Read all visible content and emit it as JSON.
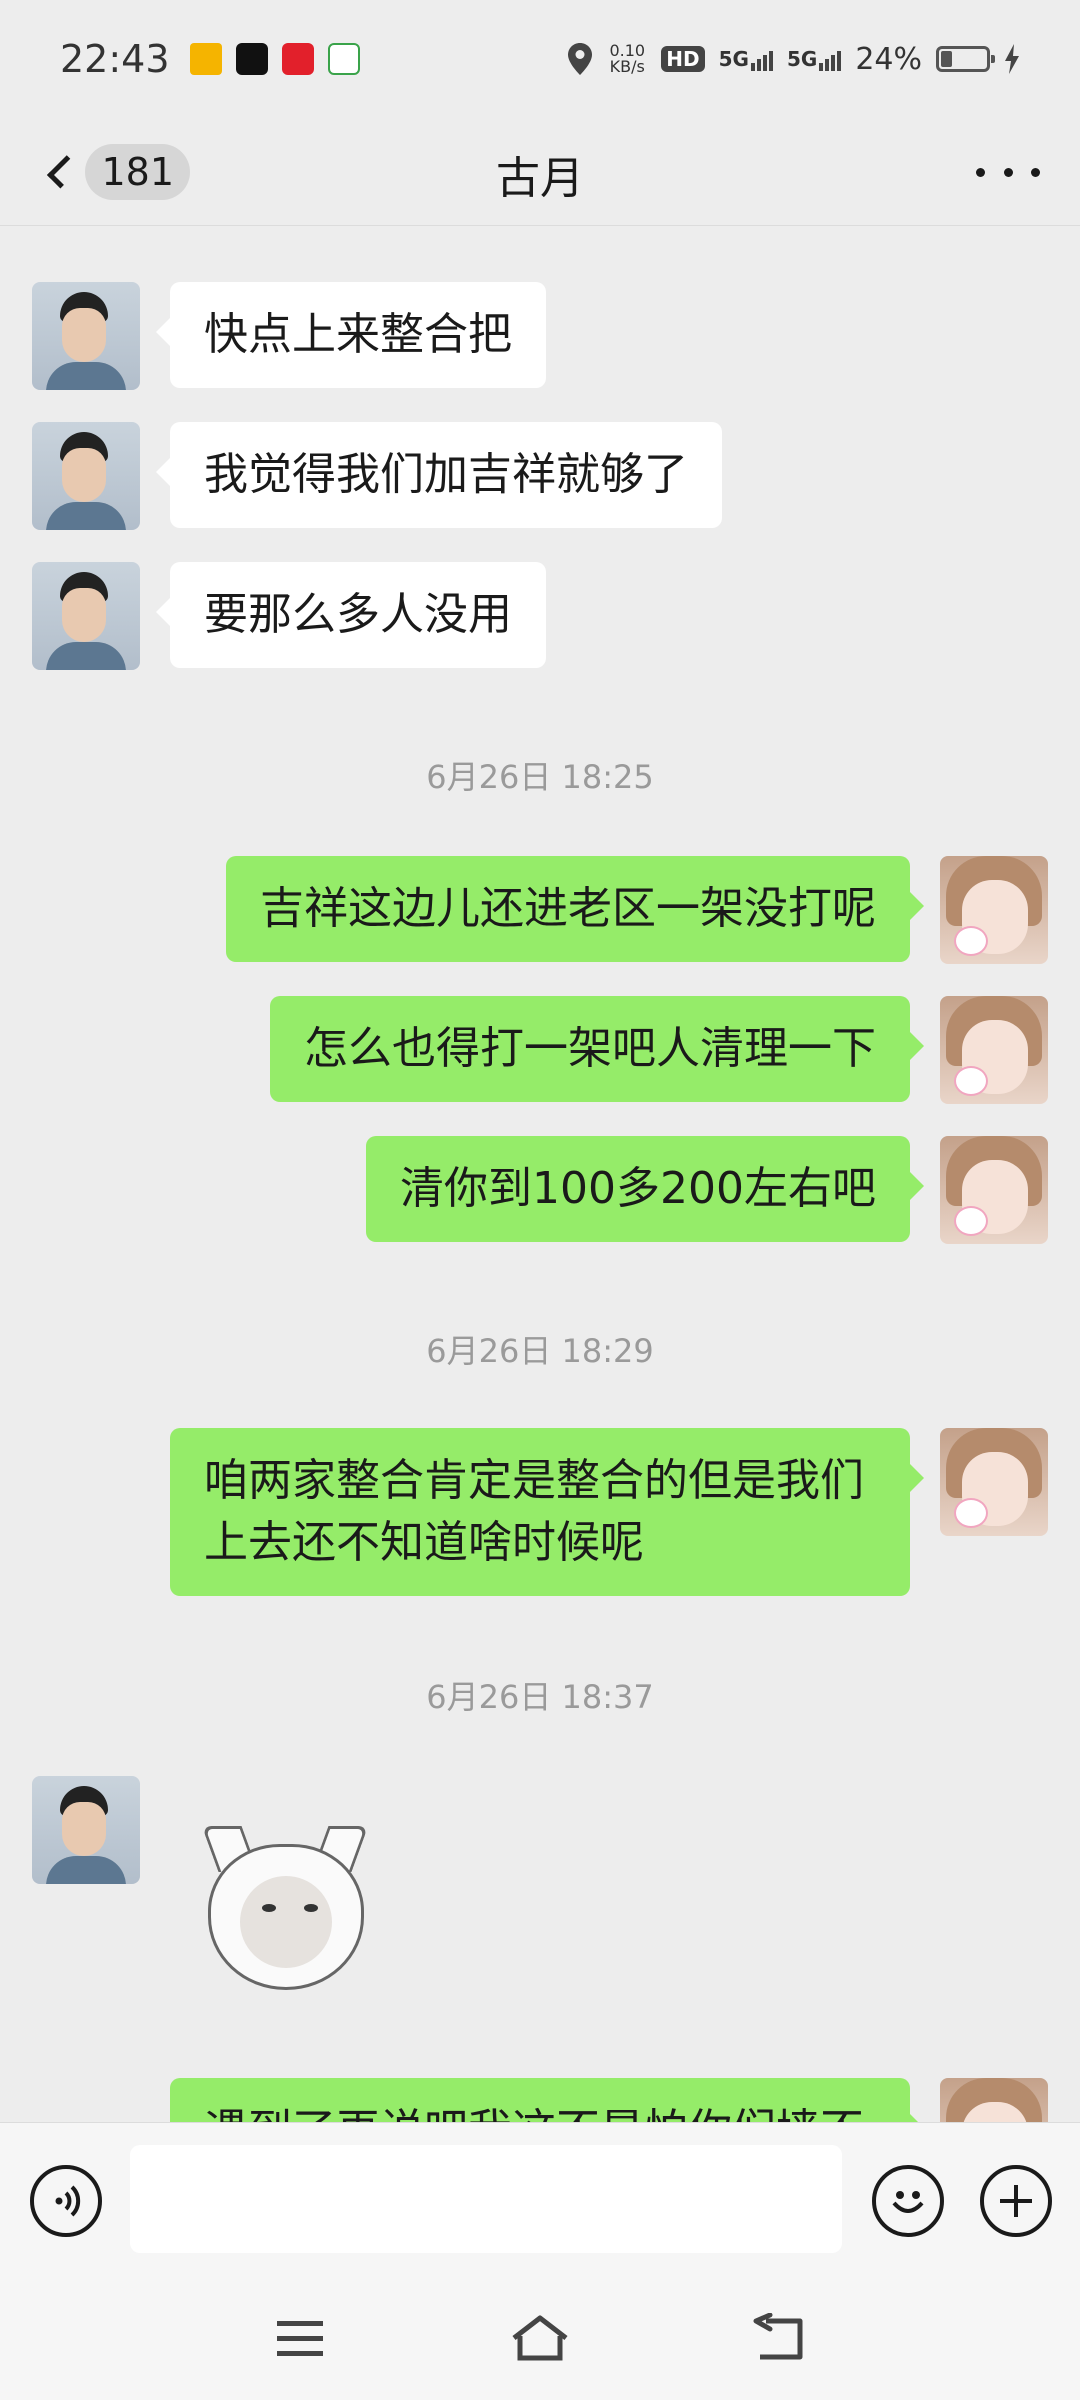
{
  "status_bar": {
    "time": "22:43",
    "net_speed_value": "0.10",
    "net_speed_unit": "KB/s",
    "hd": "HD",
    "sim1": "5G",
    "sim2": "5G",
    "battery": "24%",
    "battery_level": 0.24
  },
  "header": {
    "unread_count": "181",
    "title": "古月"
  },
  "messages": [
    {
      "side": "left",
      "text": "快点上来整合把"
    },
    {
      "side": "left",
      "text": "我觉得我们加吉祥就够了"
    },
    {
      "side": "left",
      "text": "要那么多人没用"
    },
    {
      "side": "time",
      "text": "6月26日 18:25"
    },
    {
      "side": "right",
      "text": "吉祥这边儿还进老区一架没打呢"
    },
    {
      "side": "right",
      "text": "怎么也得打一架吧人清理一下"
    },
    {
      "side": "right",
      "text": "清你到100多200左右吧"
    },
    {
      "side": "time",
      "text": "6月26日 18:29"
    },
    {
      "side": "right",
      "text": "咱两家整合肯定是整合的但是我们上去还不知道啥时候呢"
    },
    {
      "side": "time",
      "text": "6月26日 18:37"
    },
    {
      "side": "left",
      "type": "sticker"
    },
    {
      "side": "right",
      "text": "遇到了再说吧我这不是怕你们墙不"
    }
  ],
  "input_bar": {
    "placeholder": ""
  },
  "icons": {
    "back": "chevron-left-icon",
    "more": "more-dots-icon",
    "voice": "voice-icon",
    "emoji": "emoji-icon",
    "plus": "plus-icon",
    "nav_menu": "menu-icon",
    "nav_home": "home-icon",
    "nav_back": "back-icon"
  },
  "colors": {
    "sent_bubble": "#95ec69",
    "received_bubble": "#ffffff",
    "background": "#ededed"
  }
}
